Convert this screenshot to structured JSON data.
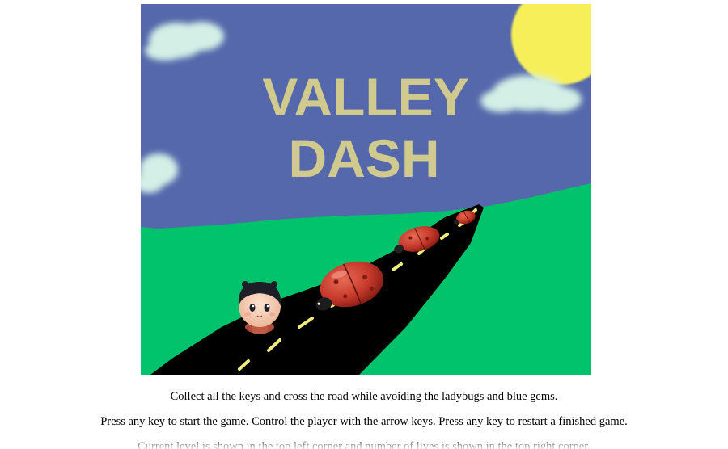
{
  "game": {
    "title_line1": "VALLEY",
    "title_line2": "DASH",
    "colors": {
      "sky": "#5468ab",
      "grass": "#00c36b",
      "road": "#000000",
      "road_dash": "#f0ec7a",
      "sun": "#f7ef5a",
      "cloud": "#d3efe6",
      "title": "#d0ca8e",
      "ladybug": "#c5382a"
    },
    "sprites": [
      "player-character",
      "ladybug-enemy",
      "ladybug-enemy",
      "ladybug-enemy"
    ]
  },
  "instructions": {
    "line1": "Collect all the keys and cross the road while avoiding the ladybugs and blue gems.",
    "line2": "Press any key to start the game. Control the player with the arrow keys. Press any key to restart a finished game.",
    "line3": "Current level is shown in the top left corner and number of lives is shown in the top right corner."
  }
}
